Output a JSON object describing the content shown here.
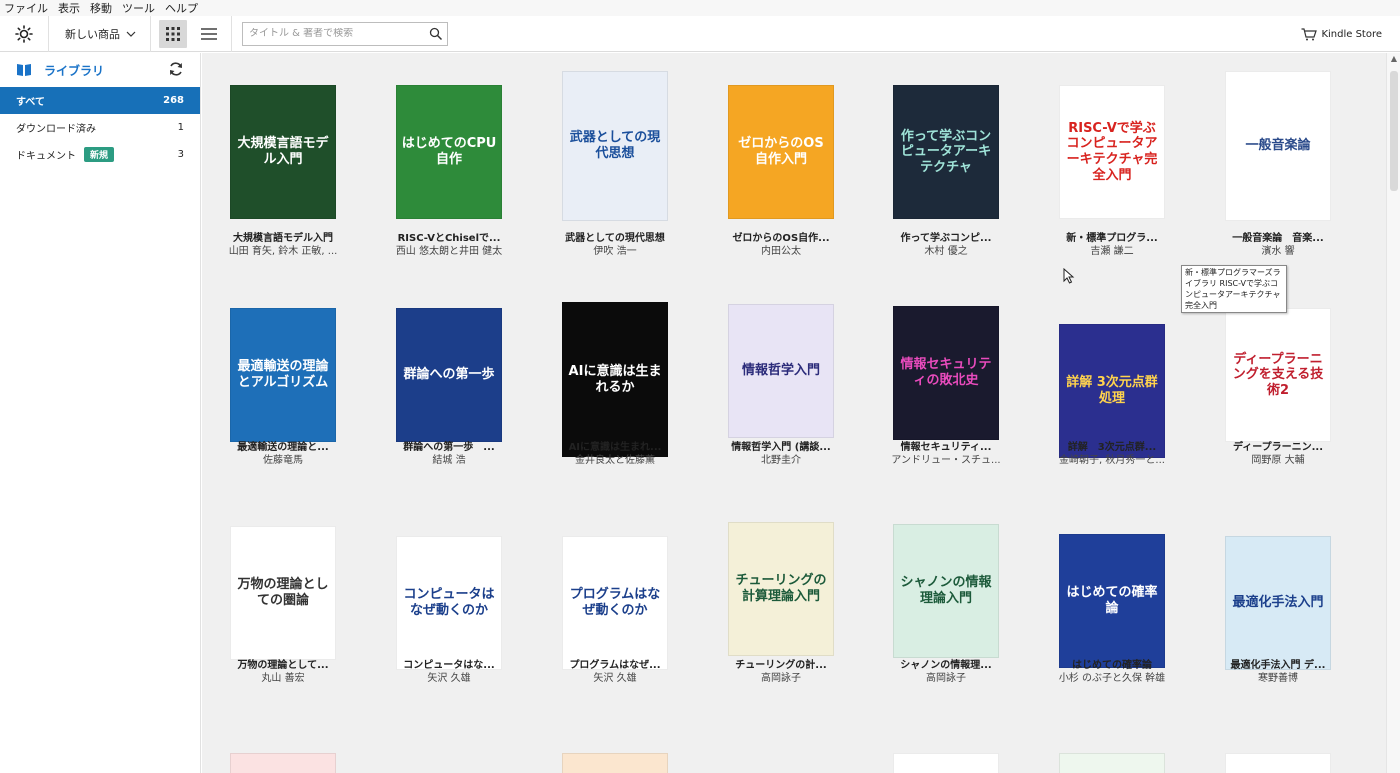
{
  "menu": [
    "ファイル",
    "表示",
    "移動",
    "ツール",
    "ヘルプ"
  ],
  "toolbar": {
    "sort_label": "新しい商品",
    "search_placeholder": "タイトル & 著者で検索",
    "store_label": "Kindle Store"
  },
  "sidebar": {
    "title": "ライブラリ",
    "items": [
      {
        "label": "すべて",
        "count": "268",
        "active": true
      },
      {
        "label": "ダウンロード済み",
        "count": "1"
      },
      {
        "label": "ドキュメント",
        "count": "3",
        "badge": "新規"
      }
    ]
  },
  "tooltip": "新・標準プログラマーズライブラリ RISC-Vで学ぶコンピュータアーキテクチャ 完全入門",
  "books": [
    {
      "title": "大規模言語モデル入門",
      "author": "山田 育矢, 鈴木 正敏, ...",
      "cover_text": "大規模言語モデル入門",
      "bg": "#1f4f2a",
      "fg": "#ffffff"
    },
    {
      "title": "RISC-VとChiselで...",
      "author": "西山 悠太朗と井田 健太",
      "cover_text": "はじめてのCPU自作",
      "bg": "#2e8b3a",
      "fg": "#ffffff"
    },
    {
      "title": "武器としての現代思想",
      "author": "伊吹 浩一",
      "cover_text": "武器としての現代思想",
      "bg": "#e9eef6",
      "fg": "#1b4f9b"
    },
    {
      "title": "ゼロからのOS自作...",
      "author": "内田公太",
      "cover_text": "ゼロからのOS自作入門",
      "bg": "#f5a623",
      "fg": "#ffffff"
    },
    {
      "title": "作って学ぶコンピ...",
      "author": "木村 優之",
      "cover_text": "作って学ぶコンピュータアーキテクチャ",
      "bg": "#1d2a3a",
      "fg": "#9fe3d8"
    },
    {
      "title": "新・標準プログラ...",
      "author": "吉瀬 謙二",
      "cover_text": "RISC-Vで学ぶコンピュータアーキテクチャ完全入門",
      "bg": "#ffffff",
      "fg": "#d8231f"
    },
    {
      "title": "一般音楽論　音楽...",
      "author": "濱水 響",
      "cover_text": "一般音楽論",
      "bg": "#ffffff",
      "fg": "#2a4a8a"
    },
    {
      "title": "最適輸送の理論と...",
      "author": "佐藤竜馬",
      "cover_text": "最適輸送の理論とアルゴリズム",
      "bg": "#1e6fb8",
      "fg": "#ffffff"
    },
    {
      "title": "群論への第一歩　...",
      "author": "結城 浩",
      "cover_text": "群論への第一歩",
      "bg": "#1c3e8a",
      "fg": "#ffffff"
    },
    {
      "title": "AIに意識は生まれ...",
      "author": "金井良太と佐藤薫",
      "cover_text": "AIに意識は生まれるか",
      "bg": "#0b0b0b",
      "fg": "#ffffff"
    },
    {
      "title": "情報哲学入門 (講談...",
      "author": "北野圭介",
      "cover_text": "情報哲学入門",
      "bg": "#e8e4f5",
      "fg": "#2b2b7a"
    },
    {
      "title": "情報セキュリティ...",
      "author": "アンドリュー・スチュ...",
      "cover_text": "情報セキュリティの敗北史",
      "bg": "#1a1a2e",
      "fg": "#e94bbd"
    },
    {
      "title": "詳解　3次元点群...",
      "author": "金崎朝子, 秋月秀一と...",
      "cover_text": "詳解 3次元点群処理",
      "bg": "#2b2f8f",
      "fg": "#ffd34d"
    },
    {
      "title": "ディープラーニン...",
      "author": "岡野原 大輔",
      "cover_text": "ディープラーニングを支える技術2",
      "bg": "#ffffff",
      "fg": "#c01f2e"
    },
    {
      "title": "万物の理論として...",
      "author": "丸山 善宏",
      "cover_text": "万物の理論としての圏論",
      "bg": "#ffffff",
      "fg": "#333333"
    },
    {
      "title": "コンピュータはな...",
      "author": "矢沢 久雄",
      "cover_text": "コンピュータはなぜ動くのか",
      "bg": "#ffffff",
      "fg": "#1b3f8b"
    },
    {
      "title": "プログラムはなぜ...",
      "author": "矢沢 久雄",
      "cover_text": "プログラムはなぜ動くのか",
      "bg": "#ffffff",
      "fg": "#1b3f8b"
    },
    {
      "title": "チューリングの計...",
      "author": "高岡詠子",
      "cover_text": "チューリングの計算理論入門",
      "bg": "#f4f0d8",
      "fg": "#1c5a3a"
    },
    {
      "title": "シャノンの情報理...",
      "author": "高岡詠子",
      "cover_text": "シャノンの情報理論入門",
      "bg": "#d9eee3",
      "fg": "#1c5a3a"
    },
    {
      "title": "はじめての確率論",
      "author": "小杉 のぶ子と久保 幹雄",
      "cover_text": "はじめての確率論",
      "bg": "#1f3f9a",
      "fg": "#ffffff"
    },
    {
      "title": "最適化手法入門 デ...",
      "author": "寒野善博",
      "cover_text": "最適化手法入門",
      "bg": "#d7eaf5",
      "fg": "#1b3f8b"
    }
  ]
}
